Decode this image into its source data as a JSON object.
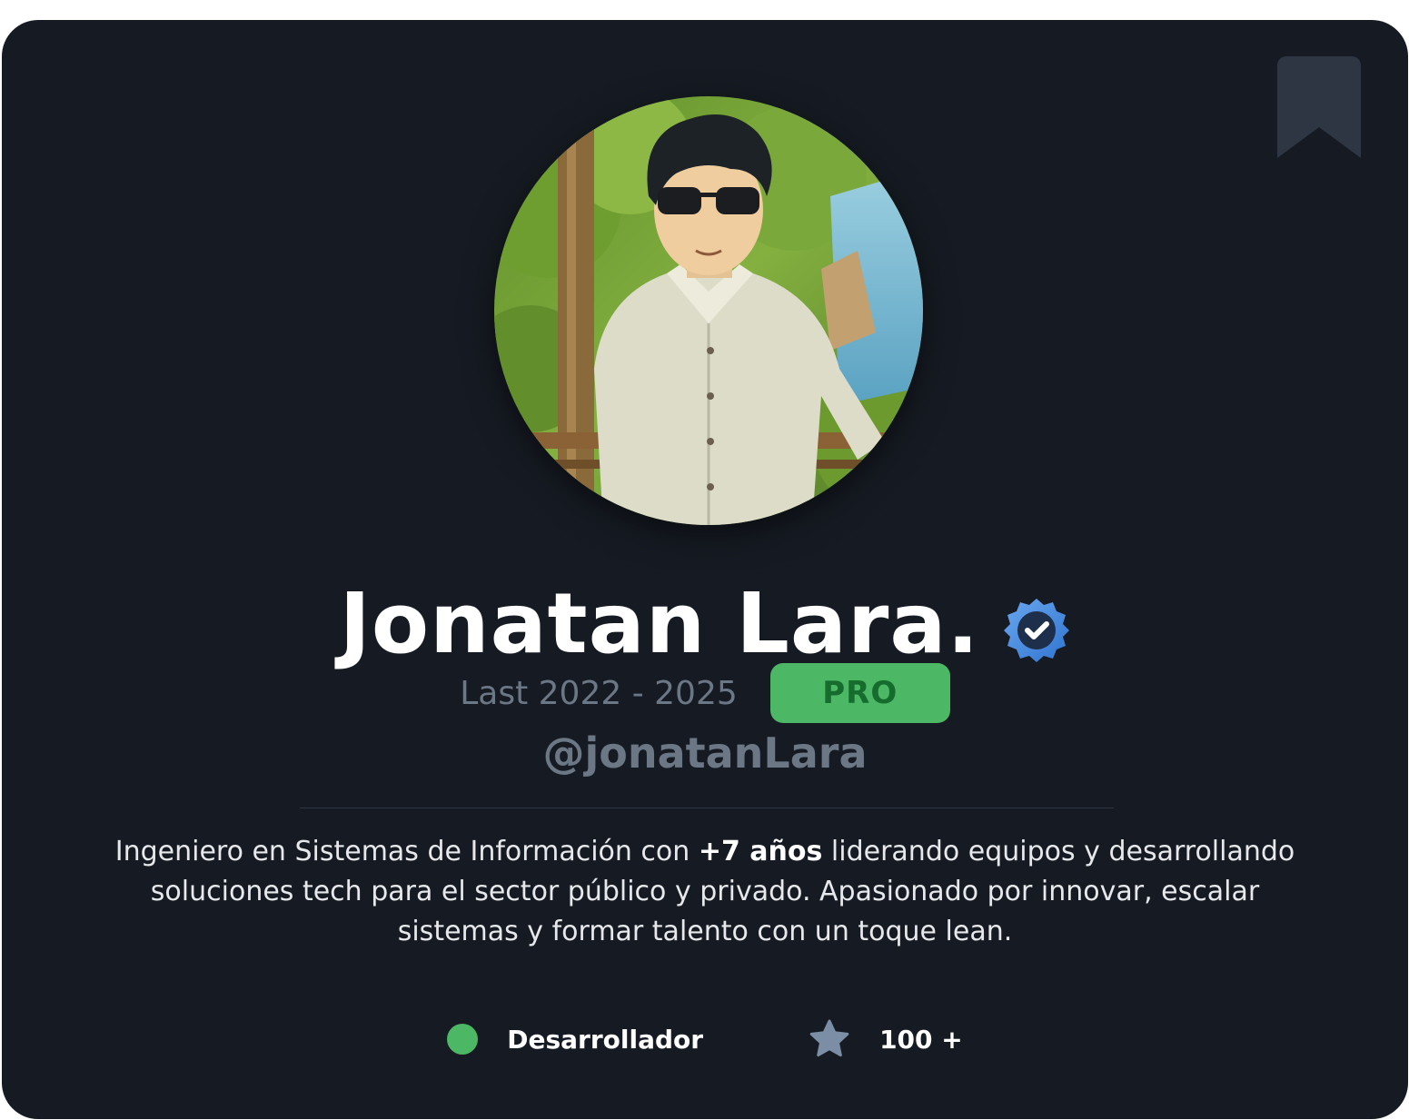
{
  "profile": {
    "name": "Jonatan Lara.",
    "verified_icon": "verified-badge-icon",
    "years": "Last 2022 - 2025",
    "badge": "PRO",
    "handle": "@jonatanLara",
    "bio": {
      "before": "Ingeniero en Sistemas de Información con ",
      "highlight": "+7 años",
      "after": " liderando equipos y desarrollando soluciones tech para el sector público y privado. Apasionado por innovar, escalar sistemas y formar talento con un toque lean."
    }
  },
  "stats": {
    "role": "Desarrollador",
    "role_status_color": "#4cb765",
    "rating_icon": "star-icon",
    "rating": "100 +"
  },
  "actions": {
    "bookmark_icon": "bookmark-icon"
  },
  "colors": {
    "card_background": "#161b23",
    "accent_green": "#4cb765",
    "muted_text": "#6c7785",
    "verified_blue": "#3f86e0"
  }
}
